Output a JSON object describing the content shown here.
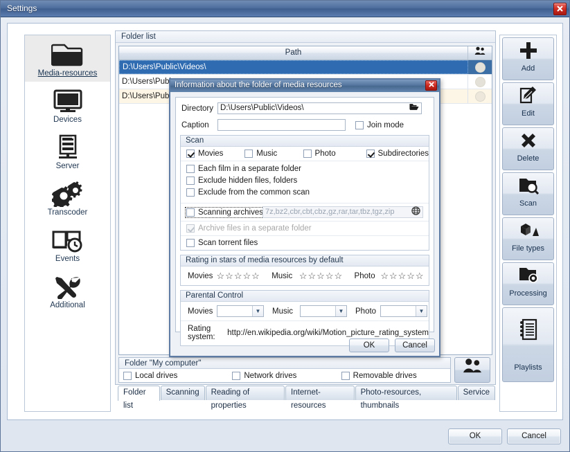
{
  "window": {
    "title": "Settings",
    "close_label": "✕"
  },
  "sidebar": {
    "items": [
      {
        "label": "Media-resources",
        "icon": "folder-icon",
        "selected": true
      },
      {
        "label": "Devices",
        "icon": "monitor-icon",
        "selected": false
      },
      {
        "label": "Server",
        "icon": "server-icon",
        "selected": false
      },
      {
        "label": "Transcoder",
        "icon": "gears-icon",
        "selected": false
      },
      {
        "label": "Events",
        "icon": "book-clock-icon",
        "selected": false
      },
      {
        "label": "Additional",
        "icon": "tools-icon",
        "selected": false
      }
    ]
  },
  "toolbar": {
    "buttons": [
      {
        "label": "Add",
        "icon": "plus-icon"
      },
      {
        "label": "Edit",
        "icon": "pencil-note-icon"
      },
      {
        "label": "Delete",
        "icon": "cross-icon"
      },
      {
        "label": "Scan",
        "icon": "folder-search-icon"
      },
      {
        "label": "File types",
        "icon": "file-types-icon"
      },
      {
        "label": "Processing",
        "icon": "folder-gear-icon"
      },
      {
        "label": "Playlists",
        "icon": "playlist-icon"
      }
    ]
  },
  "folder_list": {
    "caption": "Folder list",
    "column_header": "Path",
    "column_icon": "people-icon",
    "rows": [
      {
        "path": "D:\\Users\\Public\\Videos\\",
        "selected": true,
        "alt": false
      },
      {
        "path": "D:\\Users\\Publ",
        "selected": false,
        "alt": false
      },
      {
        "path": "D:\\Users\\Publ",
        "selected": false,
        "alt": true
      }
    ]
  },
  "my_computer": {
    "caption": "Folder \"My computer\"",
    "drives": [
      {
        "label": "Local drives",
        "checked": false
      },
      {
        "label": "Network drives",
        "checked": false
      },
      {
        "label": "Removable drives",
        "checked": false
      }
    ],
    "people_button_icon": "people-icon"
  },
  "tabs": [
    {
      "label": "Folder list",
      "active": true
    },
    {
      "label": "Scanning",
      "active": false
    },
    {
      "label": "Reading of properties",
      "active": false
    },
    {
      "label": "Internet-resources",
      "active": false
    },
    {
      "label": "Photo-resources, thumbnails",
      "active": false
    },
    {
      "label": "Service",
      "active": false
    }
  ],
  "footer": {
    "ok": "OK",
    "cancel": "Cancel"
  },
  "dialog": {
    "title": "Information about the folder of media resources",
    "close_label": "✕",
    "directory_label": "Directory",
    "directory_value": "D:\\Users\\Public\\Videos\\",
    "browse_icon": "open-folder-icon",
    "caption_label": "Caption",
    "caption_value": "",
    "join_mode": {
      "label": "Join mode",
      "checked": false
    },
    "scan": {
      "caption": "Scan",
      "types": [
        {
          "label": "Movies",
          "checked": true
        },
        {
          "label": "Music",
          "checked": false
        },
        {
          "label": "Photo",
          "checked": false
        },
        {
          "label": "Subdirectories",
          "checked": true
        }
      ],
      "options": [
        {
          "label": "Each film in a separate folder",
          "checked": false
        },
        {
          "label": "Exclude hidden files, folders",
          "checked": false
        },
        {
          "label": "Exclude from the common scan",
          "checked": false
        }
      ],
      "archives": {
        "label": "Scanning archives",
        "checked": false,
        "focused": true,
        "extensions": "7z,bz2,cbr,cbt,cbz,gz,rar,tar,tbz,tgz,zip",
        "globe_icon": "globe-icon"
      },
      "archive_separate": {
        "label": "Archive files in a separate folder",
        "checked": true,
        "disabled": true
      },
      "torrent": {
        "label": "Scan torrent files",
        "checked": false
      }
    },
    "rating": {
      "caption": "Rating in stars of media resources by default",
      "groups": [
        {
          "label": "Movies",
          "stars": 0,
          "max": 5
        },
        {
          "label": "Music",
          "stars": 0,
          "max": 5
        },
        {
          "label": "Photo",
          "stars": 0,
          "max": 5
        }
      ]
    },
    "parental": {
      "caption": "Parental Control",
      "selectors": [
        {
          "label": "Movies",
          "value": ""
        },
        {
          "label": "Music",
          "value": ""
        },
        {
          "label": "Photo",
          "value": ""
        }
      ],
      "rating_system_label": "Rating system:",
      "rating_system_url": "http://en.wikipedia.org/wiki/Motion_picture_rating_system"
    },
    "ok": "OK",
    "cancel": "Cancel"
  },
  "colors": {
    "title_blue": "#4f6f9e",
    "selection_blue": "#3a6ea5",
    "close_red": "#cd2a20",
    "alt_row": "#fdf6e6"
  }
}
